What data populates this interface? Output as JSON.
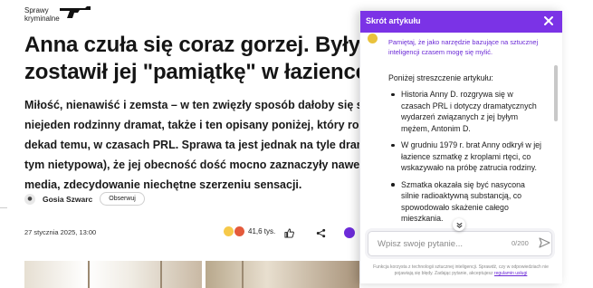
{
  "site": {
    "brand_line1": "Sprawy",
    "brand_line2": "kryminalne"
  },
  "article": {
    "headline_line1": "Anna czuła się coraz gorzej. Były ma",
    "headline_line2": "zostawił jej \"pamiątkę\" w łazience",
    "lead_lines": [
      "Miłość, nienawiść i zemsta – w ten zwięzły sposób dałoby się streścić",
      "niejeden rodzinny dramat, także i ten opisany poniżej, który rozegrał s",
      "dekad temu, w czasach PRL. Sprawa ta jest jednak na tyle dramatyczna",
      "tym nietypowa), że jej obecność dość mocno zaznaczyły nawet ówczes",
      "media, zdecydowanie niechętne szerzeniu sensacji."
    ],
    "author_name": "Gosia Szwarc",
    "follow_label": "Obserwuj",
    "date": "27 stycznia 2025, 13:00",
    "reaction_count": "41,6 tys."
  },
  "summary_panel": {
    "title": "Skrót artykułu",
    "notice": "Pamiętaj, że jako narzędzie bazujące na sztucznej inteligencji czasem mogę się mylić.",
    "intro": "Poniżej streszczenie artykułu:",
    "bullets": [
      "Historia Anny D. rozgrywa się w czasach PRL i dotyczy dramatycznych wydarzeń związanych z jej byłym mężem, Antonim D.",
      "W grudniu 1979 r. brat Anny odkrył w jej łazience szmatkę z kroplami rtęci, co wskazywało na próbę zatrucia rodziny.",
      "Szmatka okazała się być nasycona silnie radioaktywną substancją, co spowodowało skażenie całego mieszkania."
    ],
    "input_placeholder": "Wpisz swoje pytanie...",
    "char_count": "0/200",
    "disclaimer_text": "Funkcja korzysta z technologii sztucznej inteligencji. Sprawdź, czy w odpowiedziach nie pojawiają się błędy. Zadając pytanie, akceptujesz",
    "disclaimer_link": "regulamin usługi"
  },
  "colors": {
    "accent": "#7b33e6",
    "notice_text": "#6b2ad6"
  },
  "icons": [
    "revolver-icon",
    "close-icon",
    "thumbs-up-icon",
    "share-icon",
    "more-icon",
    "chevron-down-icon",
    "send-icon"
  ]
}
